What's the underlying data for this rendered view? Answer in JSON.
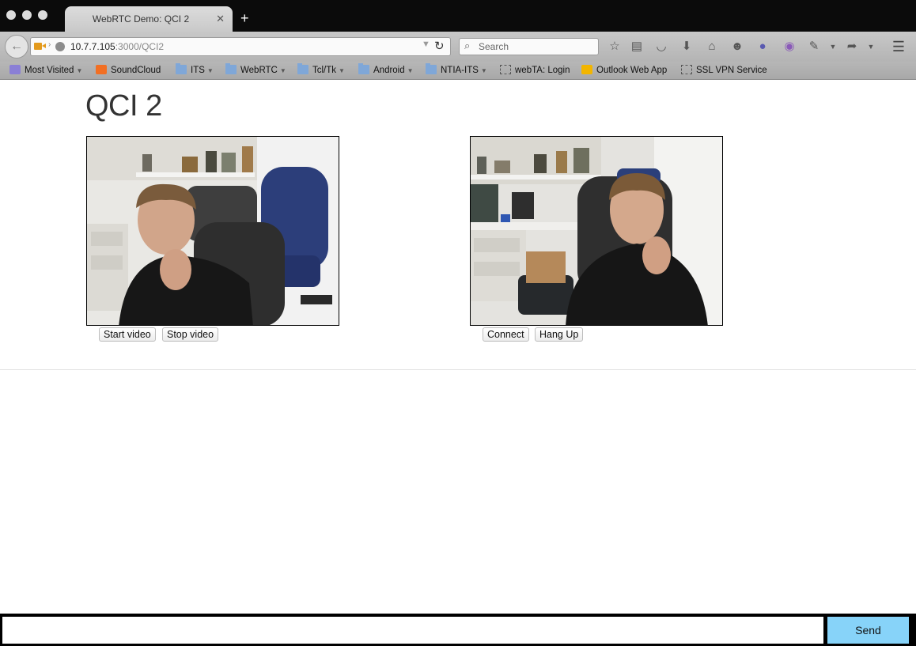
{
  "browser": {
    "tab_title": "WebRTC Demo: QCI 2",
    "tab_close": "✕",
    "new_tab": "+",
    "url_host": "10.7.7.105",
    "url_rest": ":3000/QCI2",
    "search_placeholder": "Search"
  },
  "bookmarks": [
    {
      "label": "Most Visited",
      "icon": "most-visited-icon"
    },
    {
      "label": "SoundCloud",
      "icon": "soundcloud-icon"
    },
    {
      "label": "ITS",
      "icon": "folder-icon"
    },
    {
      "label": "WebRTC",
      "icon": "folder-icon"
    },
    {
      "label": "Tcl/Tk",
      "icon": "folder-icon"
    },
    {
      "label": "Android",
      "icon": "folder-icon"
    },
    {
      "label": "NTIA-ITS",
      "icon": "folder-icon"
    },
    {
      "label": "webTA: Login",
      "icon": "page-icon"
    },
    {
      "label": "Outlook Web App",
      "icon": "outlook-icon"
    },
    {
      "label": "SSL VPN Service",
      "icon": "page-icon"
    }
  ],
  "page": {
    "title": "QCI 2",
    "local_controls": {
      "start_label": "Start video",
      "stop_label": "Stop video"
    },
    "remote_controls": {
      "connect_label": "Connect",
      "hangup_label": "Hang Up"
    }
  },
  "chat": {
    "input_value": "",
    "send_label": "Send"
  },
  "colors": {
    "send_button": "#87d3f9",
    "camera_indicator": "#e39a1d"
  }
}
